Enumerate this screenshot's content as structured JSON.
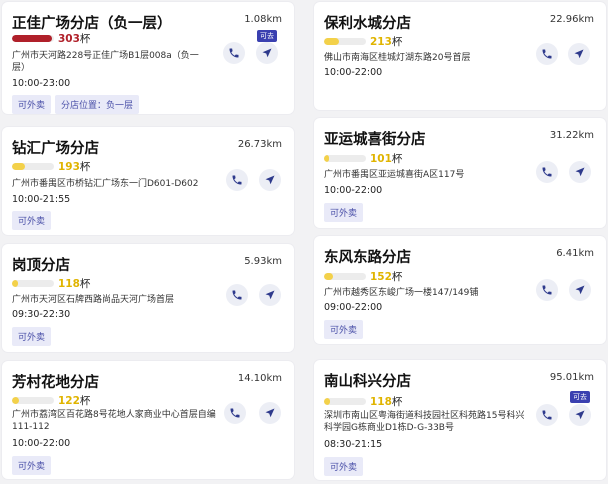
{
  "colors": {
    "accent": "#2e3a8c",
    "bar_yellow": "#f3d14a",
    "bar_red": "#b0202a",
    "tag_bg": "#e9eaf8",
    "tag_text": "#4a50a8"
  },
  "cup_unit": "杯",
  "stores": [
    {
      "name": "正佳广场分店（负一层）",
      "distance": "1.08km",
      "cups": "303",
      "level": 0.95,
      "bar_color": "#b0202a",
      "address": "广州市天河路228号正佳广场B1层008a（负一层）",
      "hours": "10:00-23:00",
      "tags": [
        "可外卖",
        "分店位置：负一层"
      ],
      "badge": "可去"
    },
    {
      "name": "保利水城分店",
      "distance": "22.96km",
      "cups": "213",
      "level": 0.35,
      "bar_color": "#f3d14a",
      "address": "佛山市南海区桂城灯湖东路20号首层",
      "hours": "10:00-22:00",
      "tags": []
    },
    {
      "name": "钻汇广场分店",
      "distance": "26.73km",
      "cups": "193",
      "level": 0.32,
      "bar_color": "#f3d14a",
      "address": "广州市番禺区市桥钻汇广场东一门D601-D602",
      "hours": "10:00-21:55",
      "tags": [
        "可外卖"
      ]
    },
    {
      "name": "亚运城喜街分店",
      "distance": "31.22km",
      "cups": "101",
      "level": 0.12,
      "bar_color": "#f3d14a",
      "address": "广州市番禺区亚运城喜街A区117号",
      "hours": "10:00-22:00",
      "tags": [
        "可外卖"
      ]
    },
    {
      "name": "岗顶分店",
      "distance": "5.93km",
      "cups": "118",
      "level": 0.15,
      "bar_color": "#f3d14a",
      "address": "广州市天河区石牌西路尚品天河广场首层",
      "hours": "09:30-22:30",
      "tags": [
        "可外卖"
      ]
    },
    {
      "name": "东风东路分店",
      "distance": "6.41km",
      "cups": "152",
      "level": 0.22,
      "bar_color": "#f3d14a",
      "address": "广州市越秀区东峻广场一楼147/149铺",
      "hours": "09:00-22:00",
      "tags": [
        "可外卖"
      ]
    },
    {
      "name": "芳村花地分店",
      "distance": "14.10km",
      "cups": "122",
      "level": 0.16,
      "bar_color": "#f3d14a",
      "address": "广州市荔湾区百花路8号花地人家商业中心首层自编111-112",
      "hours": "10:00-22:00",
      "tags": [
        "可外卖"
      ]
    },
    {
      "name": "南山科兴分店",
      "distance": "95.01km",
      "cups": "118",
      "level": 0.15,
      "bar_color": "#f3d14a",
      "address": "深圳市南山区粤海街道科技园社区科苑路15号科兴科学园G栋商业D1栋D-G-33B号",
      "hours": "08:30-21:15",
      "tags": [
        "可外卖"
      ],
      "badge": "可去"
    }
  ]
}
